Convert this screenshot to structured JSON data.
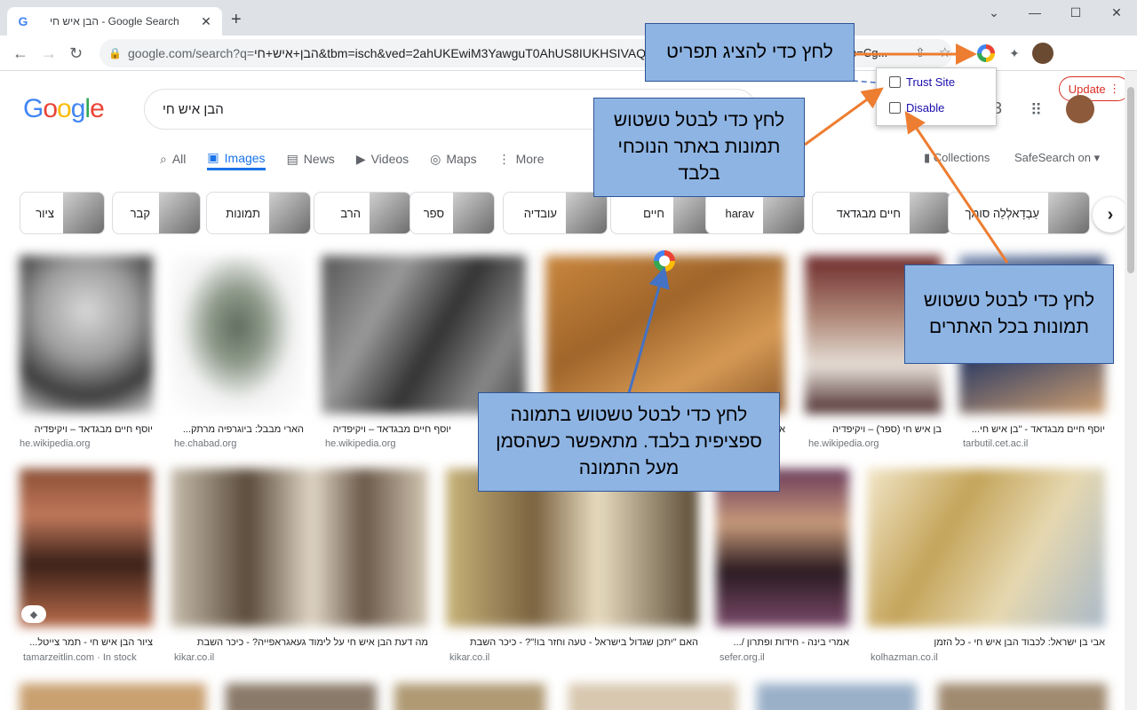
{
  "browser": {
    "tab_title": "הבן איש חי - Google Search",
    "tab_favicon": "G",
    "tab_close": "✕",
    "new_tab": "+",
    "window_controls": [
      "⌄",
      "—",
      "☐",
      "✕"
    ],
    "url_prefix": "google.com/search?q=",
    "url_rest": "הבן+איש+חי&tbm=isch&ved=2ahUKEwiM3YawguT0AhUS8IUKHSIVAQ",
    "url_end": "p=Cg...",
    "update_label": "Update",
    "update_menu": "⋮"
  },
  "header": {
    "logo": [
      "G",
      "o",
      "o",
      "g",
      "l",
      "e"
    ],
    "search_value": "הבן איש חי",
    "hidden_char": "3"
  },
  "search_tabs": [
    {
      "icon": "⌕",
      "label": "All"
    },
    {
      "icon": "▣",
      "label": "Images"
    },
    {
      "icon": "▤",
      "label": "News"
    },
    {
      "icon": "▶",
      "label": "Videos"
    },
    {
      "icon": "◎",
      "label": "Maps"
    },
    {
      "icon": "⋮",
      "label": "More"
    }
  ],
  "collections_label": "Collections",
  "safesearch_label": "SafeSearch on ▾",
  "chips": [
    "ציור",
    "קבר",
    "תמונות",
    "הרב",
    "ספר",
    "עובדיה",
    "חיים",
    "harav",
    "חיים מבגדאד",
    "עַבְדָאלְלַה סומך"
  ],
  "results_row1": [
    {
      "caption": "יוסף חיים מבגדאד – ויקיפדיה",
      "source": "he.wikipedia.org"
    },
    {
      "caption": "הארי מבבל: ביוגרפיה מרתק...",
      "source": "he.chabad.org"
    },
    {
      "caption": "יוסף חיים מבגדאד – ויקיפדיה",
      "source": "he.wikipedia.org"
    },
    {
      "caption": "",
      "source": ""
    },
    {
      "caption": "בן איש חי (ספר) – ויקיפדיה",
      "source": "he.wikipedia.org"
    },
    {
      "caption": "יוסף חיים מבגדאד - \"בן איש חי...",
      "source": "tarbutil.cet.ac.il"
    }
  ],
  "results_row2": [
    {
      "caption": "ציור הבן איש חי - תמר צייטל...",
      "source": "tamarzeitlin.com · In stock"
    },
    {
      "caption": "מה דעת הבן איש חי על לימוד געאגראפייה? - כיכר השבת",
      "source": "kikar.co.il"
    },
    {
      "caption": "האם \"יתכן שגדול בישראל - טעה וחזר בו!\"? - כיכר השבת",
      "source": "kikar.co.il"
    },
    {
      "caption": "אמרי בינה - חידות ופתרון /...",
      "source": "sefer.org.il"
    },
    {
      "caption": "אבי בן ישראל: לכבוד הבן איש חי - כל הזמן",
      "source": "kolhazman.co.il"
    }
  ],
  "partial_char": "א",
  "extension_popup": {
    "trust_label": "Trust Site",
    "disable_label": "Disable"
  },
  "callouts": {
    "menu": "לחץ כדי להציג תפריט",
    "site": "לחץ כדי לבטל טשטוש תמונות באתר הנוכחי בלבד",
    "all": "לחץ כדי לבטל טשטוש תמונות בכל האתרים",
    "image": "לחץ כדי לבטל טשטוש בתמונה ספציפית בלבד. מתאפשר כשהסמן מעל התמונה"
  },
  "colors": {
    "callout_fill": "#8eb4e3",
    "callout_border": "#2f5597",
    "arrow_orange": "#ed7d31",
    "arrow_blue": "#4472c4",
    "accent": "#1a73e8"
  }
}
